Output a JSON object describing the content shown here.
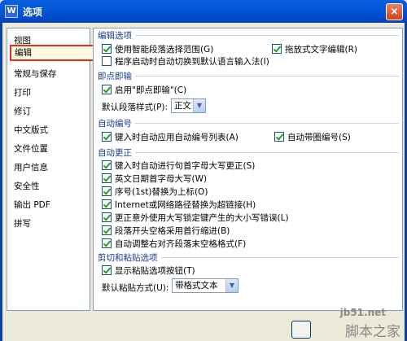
{
  "window": {
    "app_icon": "W",
    "title": "选项",
    "close": "×"
  },
  "sidebar": {
    "items": [
      {
        "label": "视图"
      },
      {
        "label": "编辑",
        "selected": true
      },
      {
        "label": "常规与保存"
      },
      {
        "label": "打印"
      },
      {
        "label": "修订"
      },
      {
        "label": "中文版式"
      },
      {
        "label": "文件位置"
      },
      {
        "label": "用户信息"
      },
      {
        "label": "安全性"
      },
      {
        "label": "输出 PDF"
      },
      {
        "label": "拼写"
      }
    ]
  },
  "sections": {
    "edit_options": {
      "title": "编辑选项",
      "smart_para": {
        "label": "使用智能段落选择范围(G)",
        "checked": true
      },
      "drag_drop": {
        "label": "拖放式文字编辑(R)",
        "checked": true
      },
      "auto_ime": {
        "label": "程序启动时自动切换到默认语言输入法(I)",
        "checked": false
      }
    },
    "click_n_type": {
      "title": "即点即输",
      "enable": {
        "label": "启用\"即点即输\"(C)",
        "checked": true
      },
      "default_style_label": "默认段落样式(P):",
      "default_style_value": "正文"
    },
    "auto_number": {
      "title": "自动编号",
      "auto_list": {
        "label": "键入时自动应用自动编号列表(A)",
        "checked": true
      },
      "auto_circle": {
        "label": "自动带圈编号(S)",
        "checked": true
      }
    },
    "auto_correct": {
      "title": "自动更正",
      "items": [
        {
          "label": "键入时自动进行句首字母大写更正(S)",
          "checked": true
        },
        {
          "label": "英文日期首字母大写(W)",
          "checked": true
        },
        {
          "label": "序号(1st)替换为上标(O)",
          "checked": true
        },
        {
          "label": "Internet或网络路径替换为超链接(H)",
          "checked": true
        },
        {
          "label": "更正意外使用大写锁定键产生的大小写错误(L)",
          "checked": true
        },
        {
          "label": "段落开头空格采用首行缩进(B)",
          "checked": true
        },
        {
          "label": "自动调整右对齐段落末空格格式(F)",
          "checked": true
        }
      ]
    },
    "cut_paste": {
      "title": "剪切和粘贴选项",
      "show_paste_btn": {
        "label": "显示粘贴选项按钮(T)",
        "checked": true
      },
      "default_paste_label": "默认粘贴方式(U):",
      "default_paste_value": "带格式文本"
    }
  },
  "watermark": {
    "url": "jb51.net",
    "name": "脚本之家"
  },
  "icons": {
    "dropdown_arrow": "chevron-down-icon",
    "checkbox": "check-icon"
  }
}
